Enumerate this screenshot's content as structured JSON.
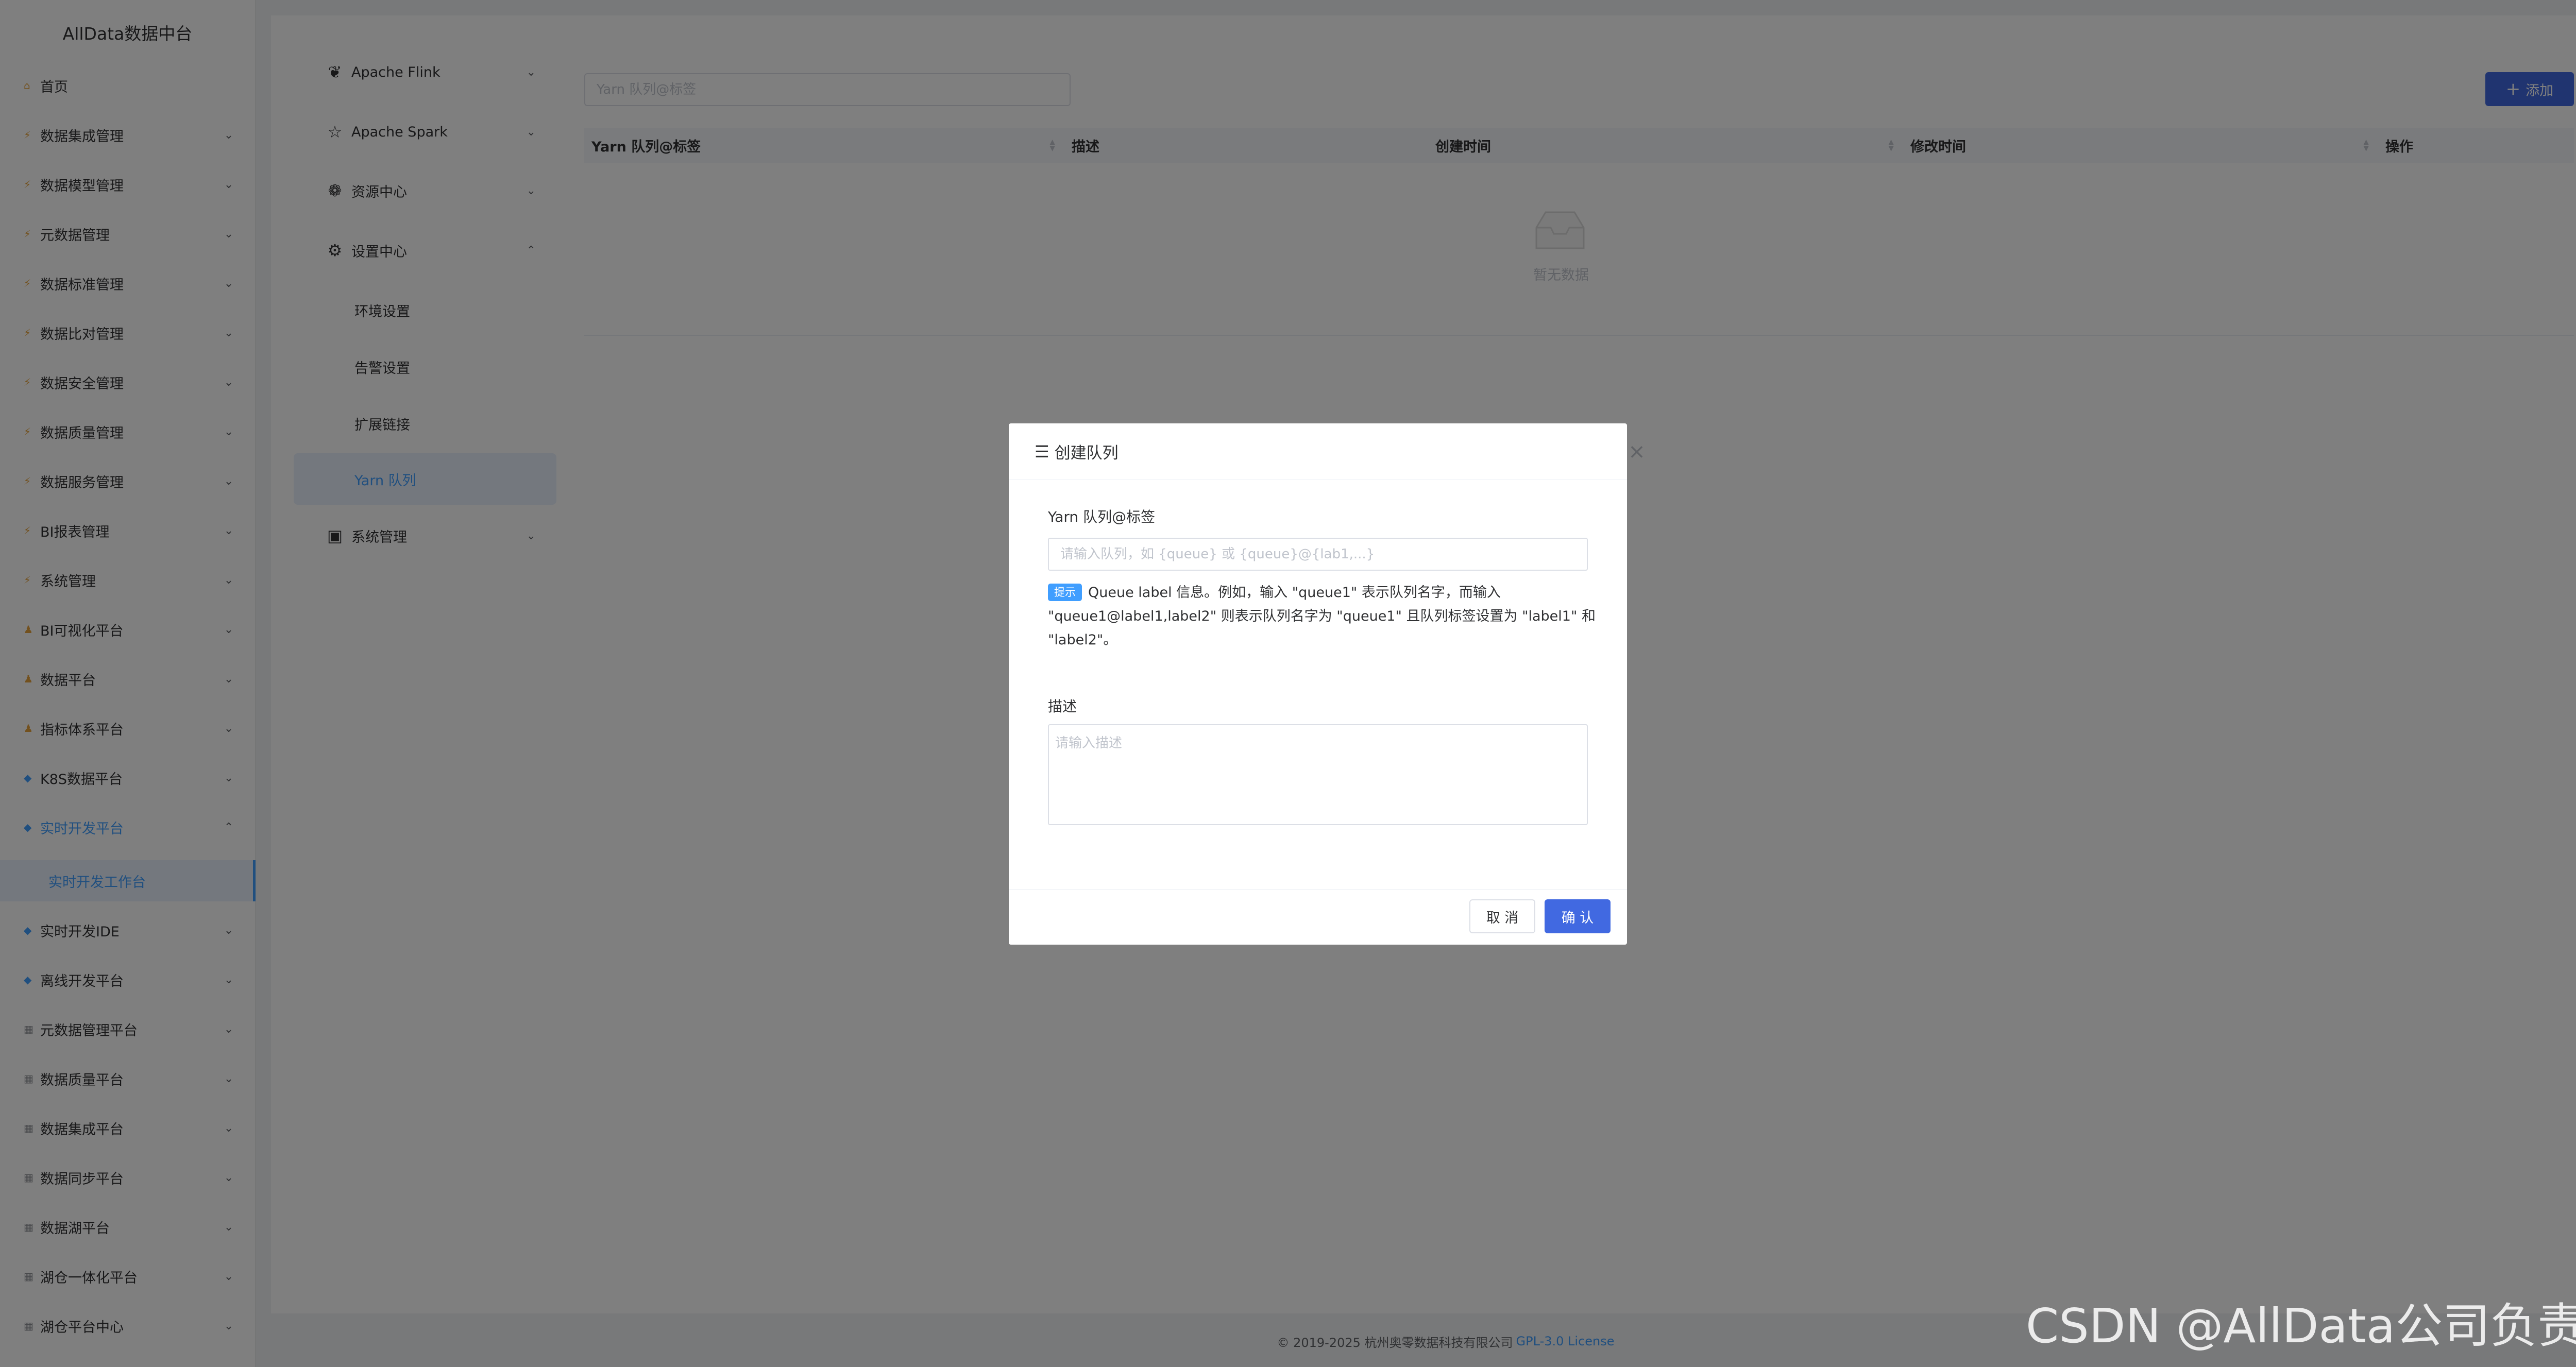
{
  "app": {
    "brand": "AllData数据中台"
  },
  "sidebar": {
    "items": [
      {
        "label": "首页",
        "icon": "home-icon",
        "glyph": "⌂",
        "tone": "orange"
      },
      {
        "label": "数据集成管理",
        "icon": "bolt-icon",
        "glyph": "⚡",
        "tone": "orange"
      },
      {
        "label": "数据模型管理",
        "icon": "bolt-icon",
        "glyph": "⚡",
        "tone": "orange"
      },
      {
        "label": "元数据管理",
        "icon": "bolt-icon",
        "glyph": "⚡",
        "tone": "orange"
      },
      {
        "label": "数据标准管理",
        "icon": "bolt-icon",
        "glyph": "⚡",
        "tone": "orange"
      },
      {
        "label": "数据比对管理",
        "icon": "bolt-icon",
        "glyph": "⚡",
        "tone": "orange"
      },
      {
        "label": "数据安全管理",
        "icon": "bolt-icon",
        "glyph": "⚡",
        "tone": "orange"
      },
      {
        "label": "数据质量管理",
        "icon": "bolt-icon",
        "glyph": "⚡",
        "tone": "orange"
      },
      {
        "label": "数据服务管理",
        "icon": "bolt-icon",
        "glyph": "⚡",
        "tone": "orange"
      },
      {
        "label": "BI报表管理",
        "icon": "bolt-icon",
        "glyph": "⚡",
        "tone": "orange"
      },
      {
        "label": "系统管理",
        "icon": "bolt-icon",
        "glyph": "⚡",
        "tone": "orange"
      },
      {
        "label": "BI可视化平台",
        "icon": "person-icon",
        "glyph": "♟",
        "tone": "orange"
      },
      {
        "label": "数据平台",
        "icon": "person-icon",
        "glyph": "♟",
        "tone": "orange"
      },
      {
        "label": "指标体系平台",
        "icon": "person-icon",
        "glyph": "♟",
        "tone": "orange"
      },
      {
        "label": "K8S数据平台",
        "icon": "gem-icon",
        "glyph": "◆",
        "tone": "blue"
      },
      {
        "label": "实时开发平台",
        "icon": "gem-icon",
        "glyph": "◆",
        "tone": "blue",
        "active": true,
        "expanded": true
      },
      {
        "label": "实时开发IDE",
        "icon": "gem-icon",
        "glyph": "◆",
        "tone": "blue"
      },
      {
        "label": "离线开发平台",
        "icon": "gem-icon",
        "glyph": "◆",
        "tone": "blue"
      },
      {
        "label": "元数据管理平台",
        "icon": "grid-icon",
        "glyph": "▦",
        "tone": "gray"
      },
      {
        "label": "数据质量平台",
        "icon": "grid-icon",
        "glyph": "▦",
        "tone": "gray"
      },
      {
        "label": "数据集成平台",
        "icon": "grid-icon",
        "glyph": "▦",
        "tone": "gray"
      },
      {
        "label": "数据同步平台",
        "icon": "grid-icon",
        "glyph": "▦",
        "tone": "gray"
      },
      {
        "label": "数据湖平台",
        "icon": "grid-icon",
        "glyph": "▦",
        "tone": "gray"
      },
      {
        "label": "湖仓一体化平台",
        "icon": "grid-icon",
        "glyph": "▦",
        "tone": "gray"
      },
      {
        "label": "湖仓平台中心",
        "icon": "grid-icon",
        "glyph": "▦",
        "tone": "gray"
      }
    ],
    "sub_item": "实时开发工作台"
  },
  "subnav": {
    "items": [
      {
        "label": "Apache Flink",
        "icon": "flink-icon",
        "glyph": "❦",
        "chevron": "down"
      },
      {
        "label": "Apache Spark",
        "icon": "spark-icon",
        "glyph": "☆",
        "chevron": "down"
      },
      {
        "label": "资源中心",
        "icon": "resource-icon",
        "glyph": "❁",
        "chevron": "down"
      },
      {
        "label": "设置中心",
        "icon": "gear-icon",
        "glyph": "⚙",
        "chevron": "up"
      }
    ],
    "children": [
      "环境设置",
      "告警设置",
      "扩展链接",
      "Yarn 队列"
    ],
    "last": {
      "label": "系统管理",
      "icon": "monitor-icon",
      "glyph": "▣",
      "chevron": "down"
    }
  },
  "content": {
    "search_placeholder": "Yarn 队列@标签",
    "add_label": "添加",
    "columns": [
      "Yarn 队列@标签",
      "描述",
      "创建时间",
      "修改时间",
      "操作"
    ],
    "empty_text": "暂无数据"
  },
  "footer": {
    "copyright": "© 2019-2025 杭州奥零数据科技有限公司",
    "license": "GPL-3.0 License"
  },
  "dialog": {
    "title": "创建队列",
    "queue_label": "Yarn 队列@标签",
    "queue_placeholder": "请输入队列，如 {queue} 或 {queue}@{lab1,...}",
    "tip_badge": "提示",
    "tip_text": "Queue label 信息。例如，输入 \"queue1\" 表示队列名字，而输入 \"queue1@label1,label2\" 则表示队列名字为 \"queue1\" 且队列标签设置为 \"label1\" 和 \"label2\"。",
    "desc_label": "描述",
    "desc_placeholder": "请输入描述",
    "cancel_label": "取 消",
    "ok_label": "确 认"
  },
  "watermark": "CSDN @AllData公司负责人",
  "colors": {
    "primary": "#4169e1",
    "accent": "#409eff",
    "overlay": "rgba(0,0,0,0.5)"
  }
}
